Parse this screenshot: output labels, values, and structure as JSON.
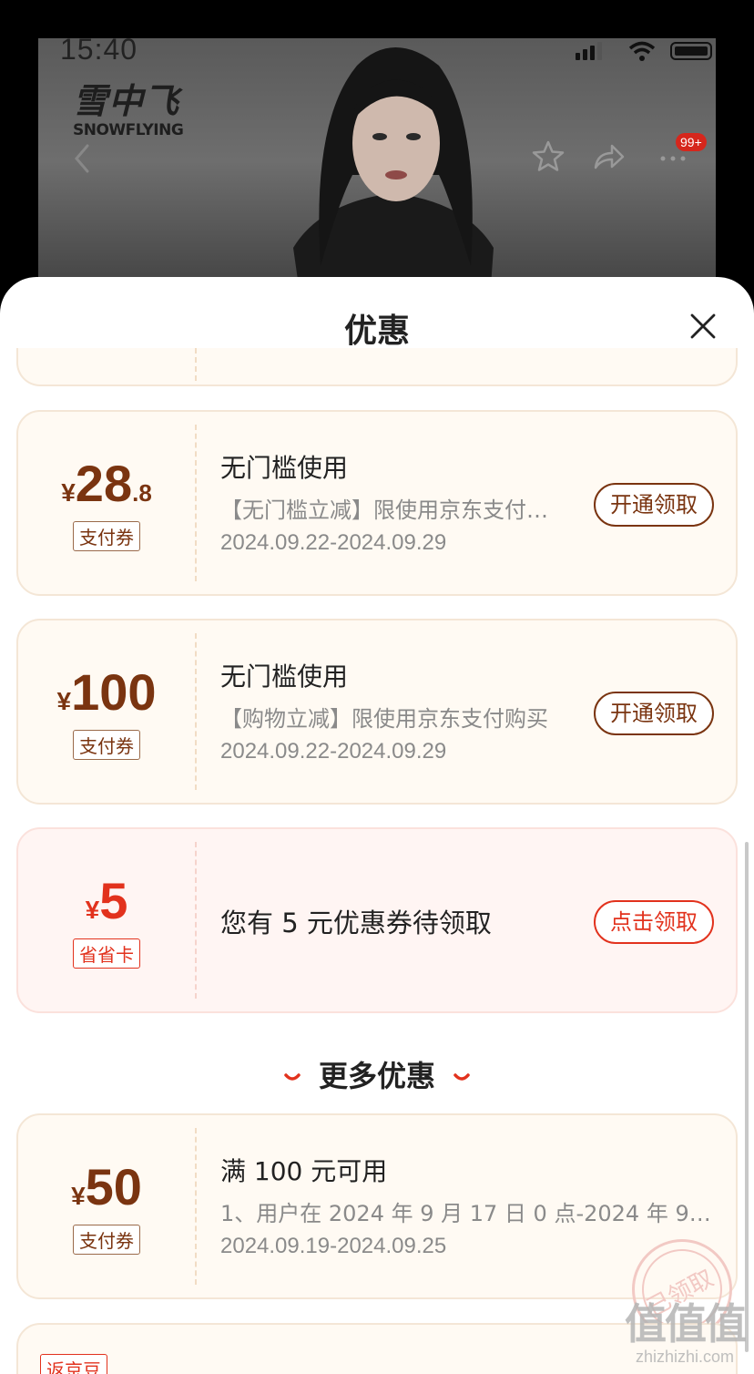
{
  "status_bar": {
    "time": "15:40"
  },
  "background_page": {
    "brand_cn": "雪中飞",
    "brand_en": "SNOWFLYING",
    "badge": "99+"
  },
  "sheet": {
    "title": "优惠",
    "coupons": [
      {
        "currency": "¥",
        "amount_int": "28",
        "amount_dec": ".8",
        "tag": "支付券",
        "title": "无门槛使用",
        "desc": "【无门槛立减】限使用京东支付购买",
        "date": "2024.09.22-2024.09.29",
        "action": "开通领取"
      },
      {
        "currency": "¥",
        "amount_int": "100",
        "amount_dec": "",
        "tag": "支付券",
        "title": "无门槛使用",
        "desc": "【购物立减】限使用京东支付购买",
        "date": "2024.09.22-2024.09.29",
        "action": "开通领取"
      },
      {
        "currency": "¥",
        "amount_int": "5",
        "amount_dec": "",
        "tag": "省省卡",
        "text": "您有 5 元优惠券待领取",
        "action": "点击领取"
      }
    ],
    "more_title": "更多优惠",
    "more_coupons": [
      {
        "currency": "¥",
        "amount_int": "50",
        "amount_dec": "",
        "tag": "支付券",
        "title": "满 100 元可用",
        "desc": "1、用户在 2024 年 9 月 17 日 0 点-2024 年 9 月...",
        "date": "2024.09.19-2024.09.25",
        "stamp": "已领取"
      },
      {
        "tag": "返京豆"
      }
    ]
  },
  "watermark": {
    "logo": "值值值",
    "url": "zhizhizhi.com"
  }
}
